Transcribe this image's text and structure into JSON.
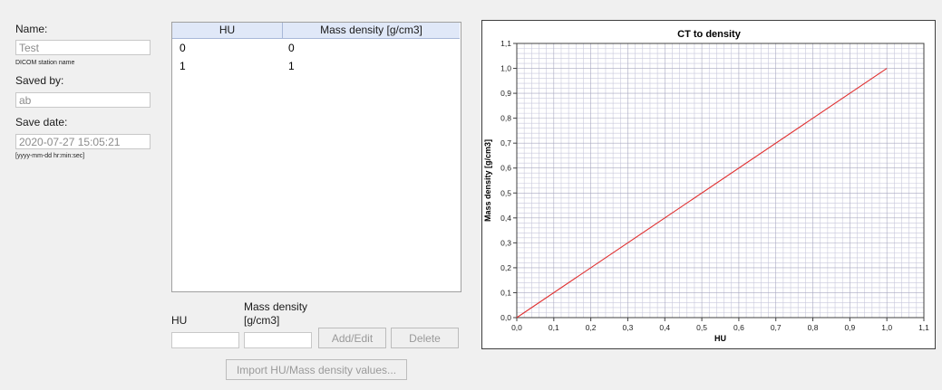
{
  "form": {
    "name_label": "Name:",
    "name_value": "Test",
    "name_hint": "DICOM station name",
    "saved_by_label": "Saved by:",
    "saved_by_value": "ab",
    "save_date_label": "Save date:",
    "save_date_value": "2020-07-27 15:05:21",
    "save_date_hint": "[yyyy-mm-dd hr:min:sec]"
  },
  "table": {
    "columns": [
      "HU",
      "Mass density [g/cm3]"
    ],
    "rows": [
      [
        "0",
        "0"
      ],
      [
        "1",
        "1"
      ]
    ]
  },
  "editor": {
    "hu_label": "HU",
    "density_label_line1": "Mass density",
    "density_label_line2": "[g/cm3]",
    "hu_value": "",
    "density_value": "",
    "add_edit_label": "Add/Edit",
    "delete_label": "Delete",
    "import_label": "Import HU/Mass density values..."
  },
  "colors": {
    "line": "#e03030",
    "grid": "#c8c8dc",
    "header_bg": "#e0e8f8"
  },
  "chart_data": {
    "type": "line",
    "title": "CT to density",
    "xlabel": "HU",
    "ylabel": "Mass density [g/cm3]",
    "xlim": [
      0,
      1.1
    ],
    "ylim": [
      0,
      1.1
    ],
    "x_ticks": [
      "0,0",
      "0,1",
      "0,2",
      "0,3",
      "0,4",
      "0,5",
      "0,6",
      "0,7",
      "0,8",
      "0,9",
      "1,0",
      "1,1"
    ],
    "y_ticks": [
      "0,0",
      "0,1",
      "0,2",
      "0,3",
      "0,4",
      "0,5",
      "0,6",
      "0,7",
      "0,8",
      "0,9",
      "1,0",
      "1,1"
    ],
    "grid": true,
    "series": [
      {
        "x": [
          0,
          1
        ],
        "y": [
          0,
          1
        ]
      }
    ]
  }
}
